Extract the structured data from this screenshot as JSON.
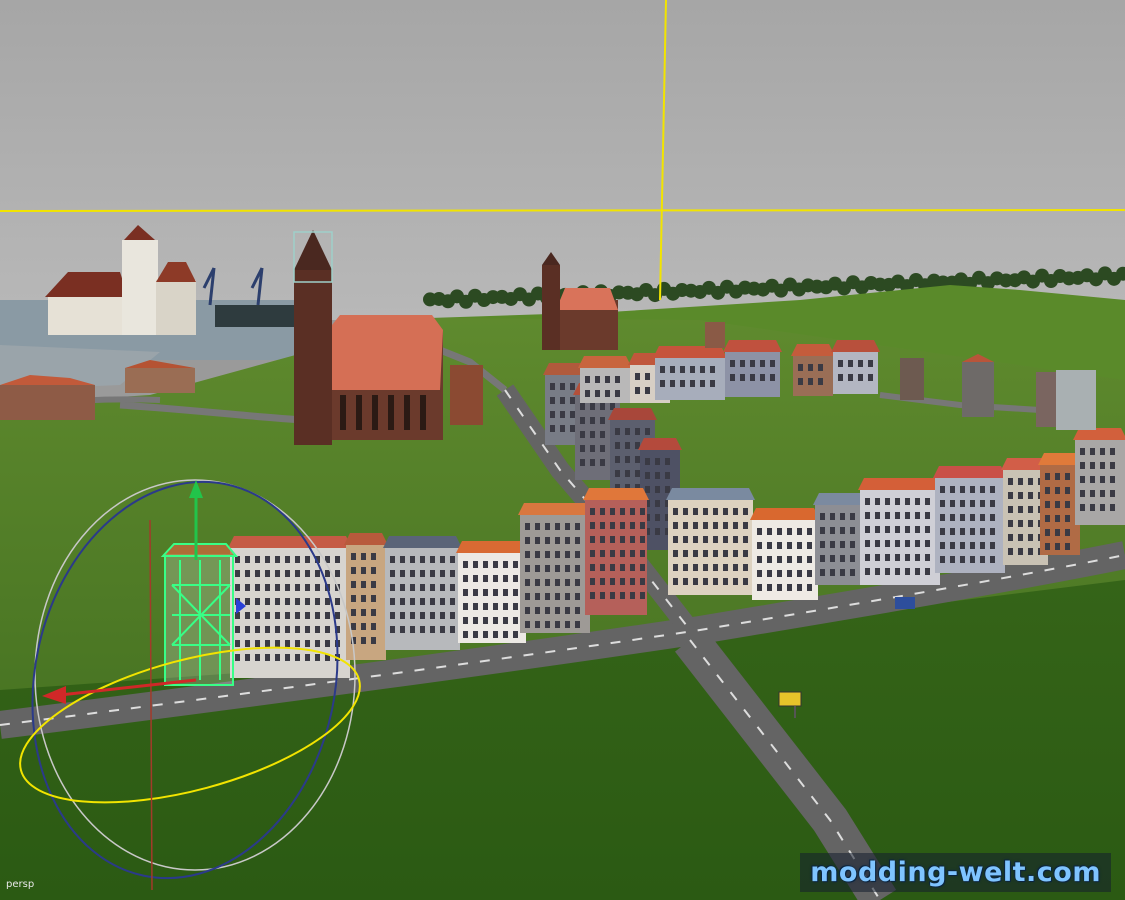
{
  "viewport": {
    "camera_label": "persp",
    "watermark": "modding-welt.com"
  },
  "colors": {
    "sky": "#a8a8a8",
    "grid_axis": "#f2e400",
    "grass": "#3f6a1e",
    "road": "#5c5c5c",
    "selection_wireframe": "#30ff7a",
    "roof": "#c9603a"
  },
  "icons": [
    "translate-manipulator",
    "rotate-manipulator",
    "road-sign"
  ]
}
